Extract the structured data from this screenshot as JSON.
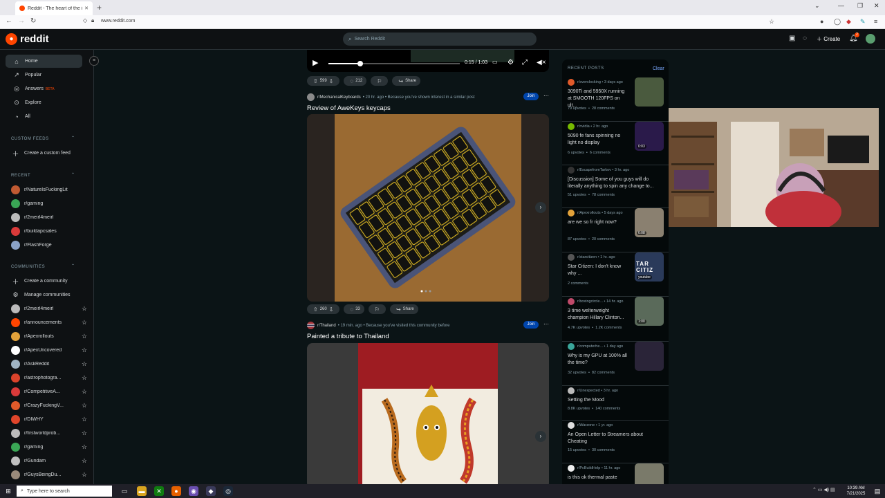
{
  "browser": {
    "tab_title": "Reddit - The heart of the internet",
    "new_tab": "+",
    "url": "www.reddit.com",
    "win_min": "⌄",
    "win_max": "—",
    "win_restore": "❐",
    "win_close": "✕"
  },
  "header": {
    "logo_text": "reddit",
    "search_placeholder": "Search Reddit",
    "create_label": "Create",
    "notif_count": "2"
  },
  "sidebar": {
    "nav": [
      {
        "label": "Home",
        "icon": "home-icon",
        "glyph": "⌂"
      },
      {
        "label": "Popular",
        "icon": "popular-icon",
        "glyph": "↗"
      },
      {
        "label": "Answers",
        "icon": "answers-icon",
        "glyph": "◎"
      },
      {
        "label": "Explore",
        "icon": "explore-icon",
        "glyph": "⊙"
      },
      {
        "label": "All",
        "icon": "all-icon",
        "glyph": "◔"
      }
    ],
    "answers_badge": "BETA",
    "custom_feeds_heading": "CUSTOM FEEDS",
    "create_custom_feed": "Create a custom feed",
    "recent_heading": "RECENT",
    "recent": [
      {
        "name": "r/NatureIsFuckingLit",
        "color": "#c05a32"
      },
      {
        "name": "r/gaming",
        "color": "#3aa655"
      },
      {
        "name": "r/2meirl4meirl",
        "color": "#bbbbbb"
      },
      {
        "name": "r/buildapcsales",
        "color": "#d93a3a"
      },
      {
        "name": "r/FlashForge",
        "color": "#8aa2c8"
      }
    ],
    "communities_heading": "COMMUNITIES",
    "create_community": "Create a community",
    "manage_communities": "Manage communities",
    "communities": [
      {
        "name": "r/2meirl4meirl",
        "color": "#bbbbbb"
      },
      {
        "name": "r/announcements",
        "color": "#ff4500"
      },
      {
        "name": "r/Apexrollouts",
        "color": "#e2a23a"
      },
      {
        "name": "r/ApexUncovered",
        "color": "#ffffff"
      },
      {
        "name": "r/AskReddit",
        "color": "#9fb4c4"
      },
      {
        "name": "r/astrophotogra...",
        "color": "#d9432b"
      },
      {
        "name": "r/CompetitiveA...",
        "color": "#d93a3a"
      },
      {
        "name": "r/CrazyFuckingV...",
        "color": "#e05a2a"
      },
      {
        "name": "r/DIWHY",
        "color": "#e0452a"
      },
      {
        "name": "r/firstworldprob...",
        "color": "#bbbbbb"
      },
      {
        "name": "r/gaming",
        "color": "#3aa655"
      },
      {
        "name": "r/Gundam",
        "color": "#c0c0c0"
      },
      {
        "name": "r/GuysBeingDu...",
        "color": "#9a8a7a"
      }
    ]
  },
  "video": {
    "time": "0:15 / 1:03",
    "progress": 0.24
  },
  "post0_actions": {
    "votes": "599",
    "comments": "212",
    "share": "Share"
  },
  "post1": {
    "subreddit": "r/MechanicalKeyboards",
    "age": "20 hr. ago",
    "reason": "Because you've shown interest in a similar post",
    "join": "Join",
    "title": "Review of AweKeys keycaps",
    "votes": "260",
    "comments": "33",
    "share": "Share"
  },
  "post2": {
    "subreddit": "r/Thailand",
    "age": "19 min. ago",
    "reason": "Because you've visited this community before",
    "join": "Join",
    "title": "Painted a tribute to Thailand"
  },
  "recent_panel": {
    "heading": "RECENT POSTS",
    "clear": "Clear",
    "items": [
      {
        "sub": "r/overclocking",
        "age": "3 days ago",
        "title": "3090Ti and 5950X running at SMOOTH 120FPS on ult...",
        "upvotes": "79 upvotes",
        "comments": "28 comments",
        "avcolor": "#e05a2a",
        "thumb": "#4a5a3e",
        "thumb_label": ""
      },
      {
        "sub": "r/nvidia",
        "age": "2 hr. ago",
        "title": "5090 fe fans spinning no light no display",
        "upvotes": "6 upvotes",
        "comments": "6 comments",
        "avcolor": "#76b900",
        "thumb": "#2a1a4a",
        "thumb_label": "0:03"
      },
      {
        "sub": "r/EscapefromTarkov",
        "age": "3 hr. ago",
        "title": "[Discussion] Some of you guys will do literally anything to spin any change to...",
        "upvotes": "51 upvotes",
        "comments": "78 comments",
        "avcolor": "#333333",
        "thumb": "",
        "thumb_label": ""
      },
      {
        "sub": "r/Apexrollouts",
        "age": "5 days ago",
        "title": "are we so fr right now?",
        "upvotes": "87 upvotes",
        "comments": "20 comments",
        "avcolor": "#e2a23a",
        "thumb": "#8a8070",
        "thumb_label": "0:08"
      },
      {
        "sub": "r/starcitizen",
        "age": "1 hr. ago",
        "title": "Star Citizen: I don't know why ...",
        "upvotes": "",
        "comments": "2 comments",
        "avcolor": "#555555",
        "thumb": "#2a3a5a",
        "thumb_label": "youtube",
        "thumb_text": "TAR CITIZ"
      },
      {
        "sub": "r/boxingcircle...",
        "age": "14 hr. ago",
        "title": "3 time welterweight champion Hillary Clinton...",
        "upvotes": "4.7K upvotes",
        "comments": "1.2K comments",
        "avcolor": "#c04a6a",
        "thumb": "#5a6a5a",
        "thumb_label": "1:00"
      },
      {
        "sub": "r/computerhe...",
        "age": "1 day ago",
        "title": "Why is my GPU at 100% all the time?",
        "upvotes": "32 upvotes",
        "comments": "82 comments",
        "avcolor": "#3aa69a",
        "thumb": "#2a2438",
        "thumb_label": ""
      },
      {
        "sub": "r/Unexpected",
        "age": "3 hr. ago",
        "title": "Setting the Mood",
        "upvotes": "8.8K upvotes",
        "comments": "140 comments",
        "avcolor": "#bbbbbb",
        "thumb": "",
        "thumb_label": ""
      },
      {
        "sub": "r/Warzone",
        "age": "1 yr. ago",
        "title": "An Open Letter to Streamers about Cheating",
        "upvotes": "15 upvotes",
        "comments": "30 comments",
        "avcolor": "#dddddd",
        "thumb": "",
        "thumb_label": ""
      },
      {
        "sub": "r/PcBuildHelp",
        "age": "11 hr. ago",
        "title": "is this ok thermal paste",
        "upvotes": "",
        "comments": "",
        "avcolor": "#eeeeee",
        "thumb": "#7a7a6a",
        "thumb_label": ""
      }
    ]
  },
  "taskbar": {
    "search_placeholder": "Type here to search",
    "time": "10:39 AM",
    "date": "7/21/2025"
  }
}
